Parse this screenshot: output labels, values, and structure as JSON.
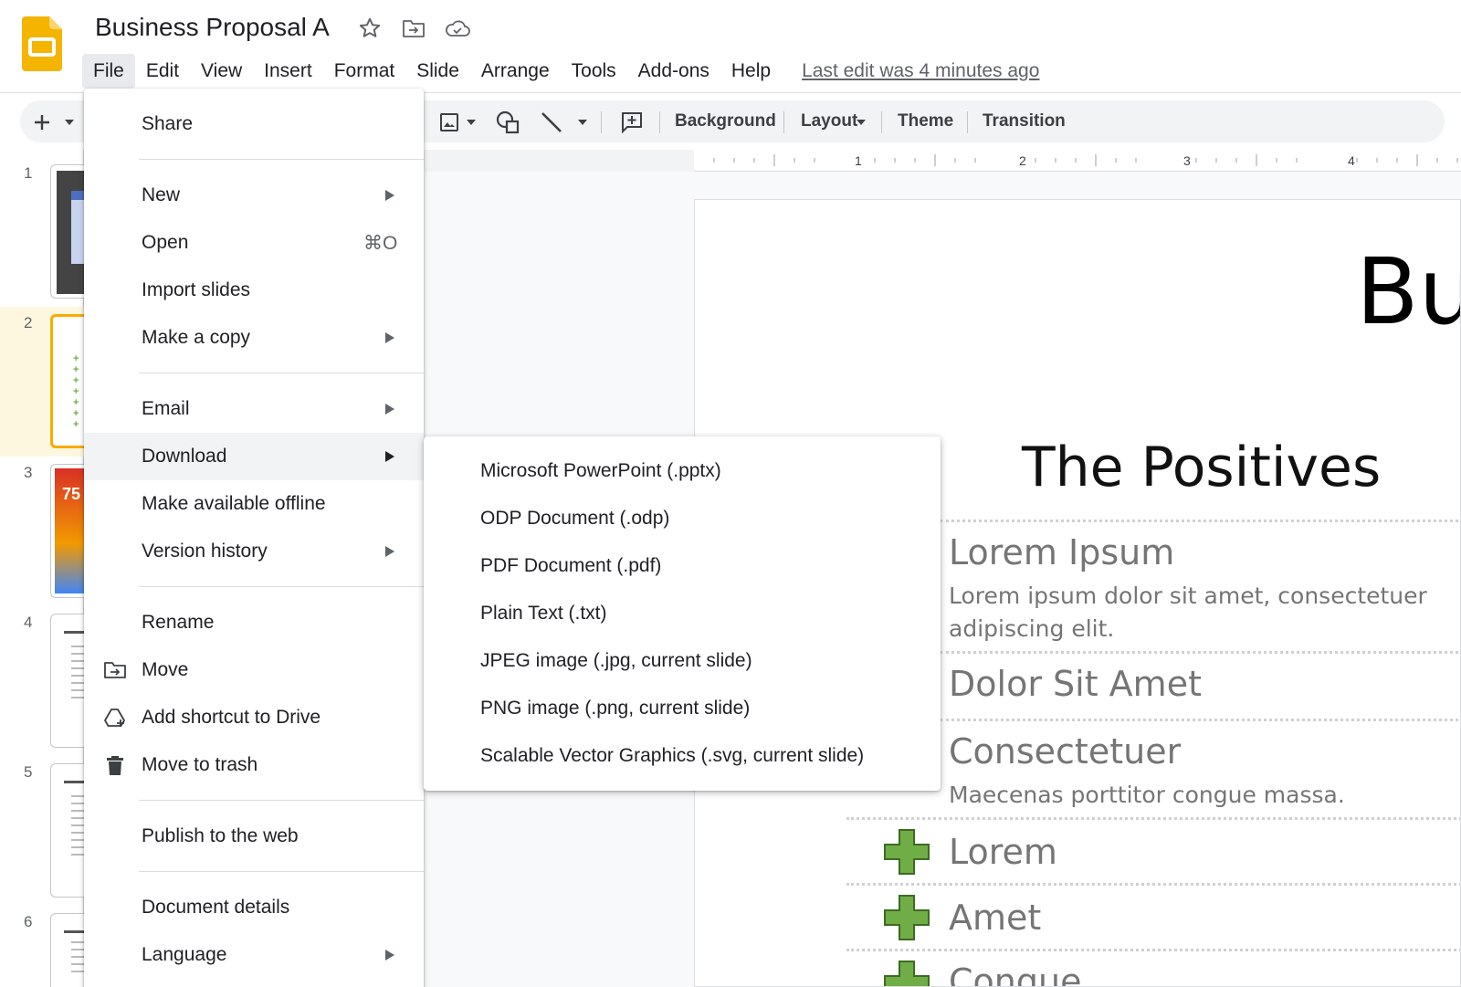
{
  "header": {
    "doc_title": "Business Proposal A",
    "menu": [
      "File",
      "Edit",
      "View",
      "Insert",
      "Format",
      "Slide",
      "Arrange",
      "Tools",
      "Add-ons",
      "Help"
    ],
    "last_edit": "Last edit was 4 minutes ago",
    "icons": [
      "star-icon",
      "move-folder-icon",
      "cloud-status-icon"
    ]
  },
  "toolbar": {
    "background": "Background",
    "layout": "Layout",
    "theme": "Theme",
    "transition": "Transition"
  },
  "ruler": {
    "labels": [
      "1",
      "2",
      "3",
      "4"
    ]
  },
  "filmstrip": {
    "slide_numbers": [
      "1",
      "2",
      "3",
      "4",
      "5",
      "6"
    ],
    "selected": "2"
  },
  "file_menu": {
    "share": "Share",
    "new": "New",
    "open": "Open",
    "open_shortcut": "⌘O",
    "import_slides": "Import slides",
    "make_copy": "Make a copy",
    "email": "Email",
    "download": "Download",
    "make_offline": "Make available offline",
    "version_history": "Version history",
    "rename": "Rename",
    "move": "Move",
    "add_shortcut": "Add shortcut to Drive",
    "move_trash": "Move to trash",
    "publish": "Publish to the web",
    "details": "Document details",
    "language": "Language"
  },
  "download_menu": {
    "pptx": "Microsoft PowerPoint (.pptx)",
    "odp": "ODP Document (.odp)",
    "pdf": "PDF Document (.pdf)",
    "txt": "Plain Text (.txt)",
    "jpg": "JPEG image (.jpg, current slide)",
    "png": "PNG image (.png, current slide)",
    "svg": "Scalable Vector Graphics (.svg, current slide)"
  },
  "slide": {
    "title_fragment": "Bu",
    "heading": "The Positives",
    "item1_title": "Lorem Ipsum",
    "item1_line1": "Lorem ipsum dolor sit amet, consectetuer",
    "item1_line2": "adipiscing elit.",
    "item2_title": "Dolor Sit Amet",
    "item3_title": "Consectetuer",
    "item3_text": "Maecenas porttitor congue massa.",
    "plus1": "Lorem",
    "plus2": "Amet",
    "plus3": "Congue"
  },
  "colors": {
    "slides_yellow": "#f4b400",
    "selected_slide_border": "#f9ab00",
    "plus_green": "#70ad47",
    "menu_highlight": "#f1f3f4"
  }
}
